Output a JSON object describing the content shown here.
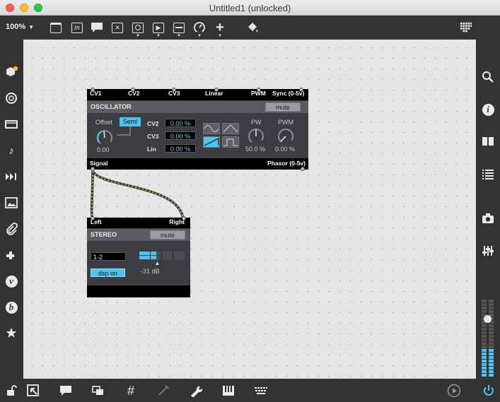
{
  "window": {
    "title": "Untitled1 (unlocked)"
  },
  "toolbar": {
    "zoom": "100%",
    "zoom_caret": "▼"
  },
  "oscillator": {
    "inputs": [
      "CV1",
      "CV2",
      "CV3",
      "Linear",
      "PWM",
      "Sync (0-5v)"
    ],
    "title": "OSCILLATOR",
    "mute": "mute",
    "offset_label": "Offset",
    "semi_label": "Semi",
    "offset_value": "0.00",
    "cv_rows": [
      {
        "label": "CV2",
        "value": "0.00 %"
      },
      {
        "label": "CV3",
        "value": "0.00 %"
      },
      {
        "label": "Lin",
        "value": "0.00 %"
      }
    ],
    "pw_label": "PW",
    "pw_value": "50.0 %",
    "pwm_label": "PWM",
    "pwm_value": "0.00 %",
    "outputs": [
      "Signal",
      "Phasor (0-5v)"
    ],
    "selected_waveform": "saw"
  },
  "stereo": {
    "inputs": [
      "Left",
      "Right"
    ],
    "title": "STEREO",
    "mute": "mute",
    "channel": "1-2",
    "dsp_button": "dsp on",
    "level_text": "-31 dB",
    "level_fraction": 0.38
  },
  "colors": {
    "accent": "#4cc4ee",
    "canvas": "#e5e5e5",
    "patch_cord": "#7a7a52"
  }
}
